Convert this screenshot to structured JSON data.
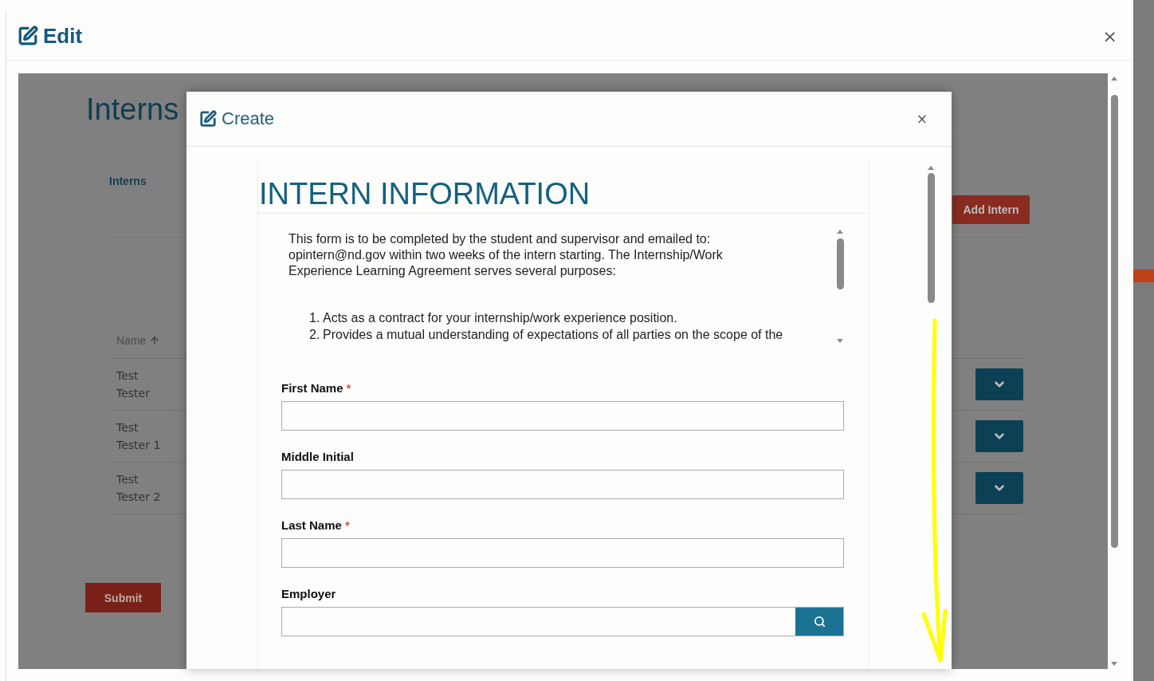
{
  "edit_dialog": {
    "title": "Edit",
    "close": "×"
  },
  "page": {
    "title": "Interns",
    "panel_label": "Interns",
    "add_button": "Add Intern",
    "column": "Name",
    "rows": [
      {
        "first": "Test",
        "last": "Tester"
      },
      {
        "first": "Test",
        "last": "Tester 1"
      },
      {
        "first": "Test",
        "last": "Tester 2"
      }
    ],
    "submit": "Submit"
  },
  "create_dialog": {
    "title": "Create",
    "close": "×",
    "heading": "INTERN INFORMATION",
    "intro": "This form is to be completed by the student and supervisor and emailed to: opintern@nd.gov within two weeks of the intern starting. The Internship/Work Experience Learning Agreement serves several purposes:",
    "required_mark": "*",
    "purposes": [
      {
        "marker": "1.",
        "text": "Acts as a contract for your internship/work experience position."
      },
      {
        "marker": "2.",
        "text": "Provides a mutual understanding of expectations of all parties on the scope of the"
      }
    ],
    "fields": [
      {
        "label": "First Name",
        "required": true,
        "kind": "text"
      },
      {
        "label": "Middle Initial",
        "required": false,
        "kind": "text"
      },
      {
        "label": "Last Name",
        "required": true,
        "kind": "text"
      },
      {
        "label": "Employer",
        "required": false,
        "kind": "lookup"
      }
    ]
  }
}
